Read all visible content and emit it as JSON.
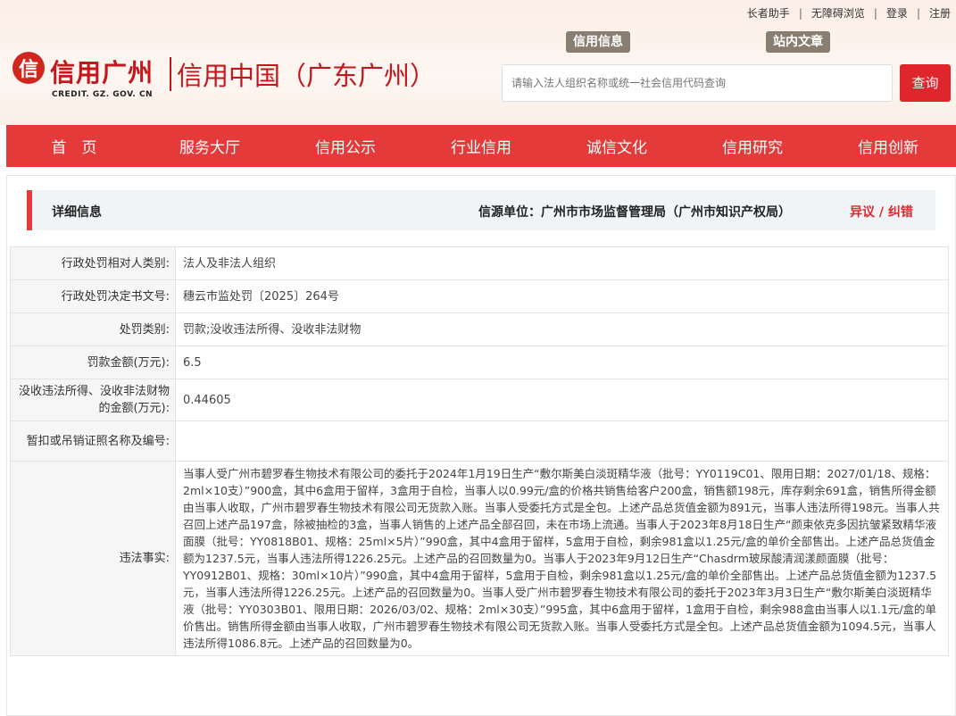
{
  "top_links": [
    "长者助手",
    "无障碍浏览",
    "登录",
    "注册"
  ],
  "logo": {
    "mark": "信",
    "name": "信用广州",
    "sub": "CREDIT. GZ. GOV. CN"
  },
  "site_title": "信用中国（广东广州）",
  "search": {
    "tabs": [
      "信用信息",
      "站内文章"
    ],
    "placeholder": "请输入法人组织名称或统一社会信用代码查询",
    "button": "查询"
  },
  "nav": [
    "首　页",
    "服务大厅",
    "信用公示",
    "行业信用",
    "诚信文化",
    "信用研究",
    "信用创新"
  ],
  "detail": {
    "title": "详细信息",
    "source": "信源单位：广州市市场监督管理局（广州市知识产权局）",
    "action": "异议 / 纠错"
  },
  "rows": [
    {
      "label": "行政处罚相对人类别:",
      "value": "法人及非法人组织"
    },
    {
      "label": "行政处罚决定书文号:",
      "value": "穗云市监处罚〔2025〕264号"
    },
    {
      "label": "处罚类别:",
      "value": "罚款;没收违法所得、没收非法财物"
    },
    {
      "label": "罚款金额(万元):",
      "value": "6.5"
    },
    {
      "label": "没收违法所得、没收非法财物的金额(万元):",
      "value": "0.44605"
    },
    {
      "label": "暂扣或吊销证照名称及编号:",
      "value": ""
    },
    {
      "label": "违法事实:",
      "value": "当事人受广州市碧罗春生物技术有限公司的委托于2024年1月19日生产“敷尔斯美白淡斑精华液（批号：YY0119C01、限用日期：2027/01/18、规格：2ml×10支）”900盒，其中6盒用于留样，3盒用于自检，当事人以0.99元/盒的价格共销售给客户200盒，销售额198元，库存剩余691盒，销售所得金额由当事人收取，广州市碧罗春生物技术有限公司无货款入账。当事人受委托方式是全包。上述产品总货值金额为891元，当事人违法所得198元。当事人共召回上述产品197盒，除被抽检的3盒，当事人销售的上述产品全部召回，未在市场上流通。当事人于2023年8月18日生产“颜束依克多因抗皱紧致精华液面膜（批号：YY0818B01、规格：25ml×5片）”990盒，其中4盒用于留样，5盒用于自检，剩余981盒以1.25元/盒的单价全部售出。上述产品总货值金额为1237.5元，当事人违法所得1226.25元。上述产品的召回数量为0。当事人于2023年9月12日生产“Chasdrm玻尿酸清润漾颜面膜（批号：YY0912B01、规格：30ml×10片）”990盒，其中4盒用于留样，5盒用于自检，剩余981盒以1.25元/盒的单价全部售出。上述产品总货值金额为1237.5元，当事人违法所得1226.25元。上述产品的召回数量为0。当事人受广州市碧罗春生物技术有限公司的委托于2023年3月3日生产“敷尔斯美白淡斑精华液（批号：YY0303B01、限用日期：2026/03/02、规格：2ml×30支）”995盒，其中6盒用于留样，1盒用于自检，剩余988盒由当事人以1.1元/盒的单价售出。销售所得金额由当事人收取，广州市碧罗春生物技术有限公司无货款入账。当事人受委托方式是全包。上述产品总货值金额为1094.5元，当事人违法所得1086.8元。上述产品的召回数量为0。"
    }
  ],
  "colors": {
    "accent": "#e43a3a",
    "brand": "#c5161d"
  }
}
